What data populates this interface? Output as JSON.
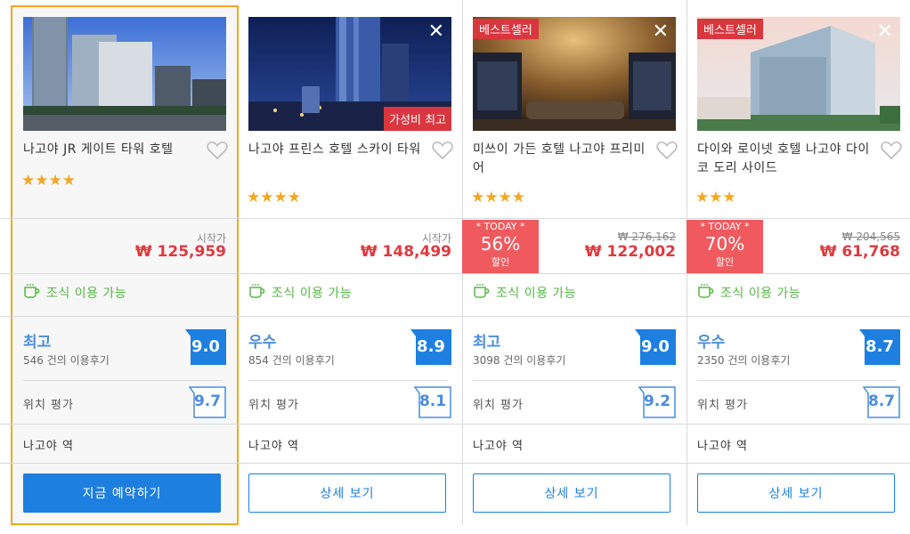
{
  "hotels": [
    {
      "name": "나고야 JR 게이트 타워 호텔",
      "stars": "★★★★",
      "badge_best": "",
      "badge_value": "",
      "start_label": "시작가",
      "price": "₩ 125,959",
      "breakfast": "조식 이용 가능",
      "rating_label": "최고",
      "reviews": "546 건의 이용후기",
      "score": "9.0",
      "loc_label": "위치 평가",
      "loc_score": "9.7",
      "station": "나고야 역",
      "button": "지금 예약하기"
    },
    {
      "name": "나고야 프린스 호텔 스카이 타워",
      "stars": "★★★★",
      "badge_value": "가성비 최고",
      "start_label": "시작가",
      "price": "₩ 148,499",
      "breakfast": "조식 이용 가능",
      "rating_label": "우수",
      "reviews": "854 건의 이용후기",
      "score": "8.9",
      "loc_label": "위치 평가",
      "loc_score": "8.1",
      "station": "나고야 역",
      "button": "상세 보기"
    },
    {
      "name": "미쓰이 가든 호텔 나고야 프리미어",
      "stars": "★★★★",
      "badge_best": "베스트셀러",
      "today": "* TODAY *",
      "discount": "56%",
      "discount_label": "할인",
      "old_price": "₩ 276,162",
      "price": "₩ 122,002",
      "breakfast": "조식 이용 가능",
      "rating_label": "최고",
      "reviews": "3098 건의 이용후기",
      "score": "9.0",
      "loc_label": "위치 평가",
      "loc_score": "9.2",
      "station": "나고야 역",
      "button": "상세 보기"
    },
    {
      "name": "다이와 로이넷 호텔 나고야 다이코 도리 사이드",
      "stars": "★★★",
      "badge_best": "베스트셀러",
      "today": "* TODAY *",
      "discount": "70%",
      "discount_label": "할인",
      "old_price": "₩ 204,565",
      "price": "₩ 61,768",
      "breakfast": "조식 이용 가능",
      "rating_label": "우수",
      "reviews": "2350 건의 이용후기",
      "score": "8.7",
      "loc_label": "위치 평가",
      "loc_score": "8.7",
      "station": "나고야 역",
      "button": "상세 보기"
    }
  ],
  "colors": {
    "accent_blue": "#1d7fe0",
    "price_red": "#e0393f",
    "badge_red": "#d9363e",
    "star_orange": "#f5a623",
    "breakfast_green": "#5ab54a",
    "selected_border": "#f5a623"
  },
  "icons": {
    "close": "close-icon",
    "heart": "heart-icon",
    "cup": "coffee-cup-icon",
    "star": "star-icon"
  }
}
